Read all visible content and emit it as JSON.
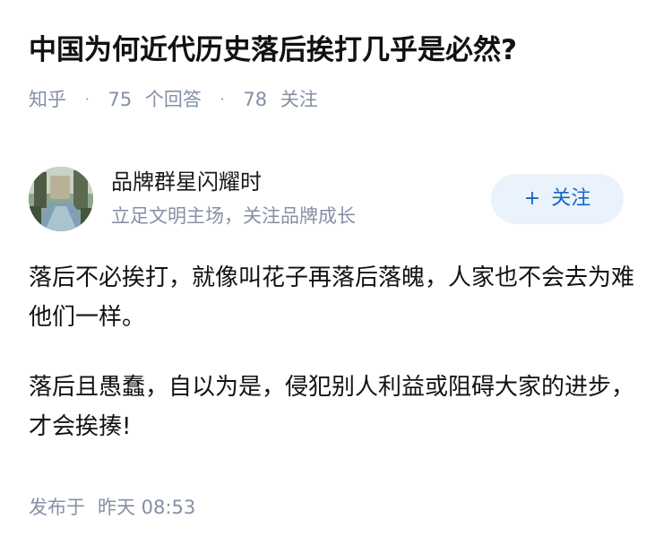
{
  "question": {
    "title": "中国为何近代历史落后挨打几乎是必然?"
  },
  "meta": {
    "source": "知乎",
    "separator": "·",
    "answers_count": "75",
    "answers_label": "个回答",
    "followers_count": "78",
    "followers_label": "关注"
  },
  "author": {
    "name": "品牌群星闪耀时",
    "bio": "立足文明主场，关注品牌成长",
    "follow_plus": "+",
    "follow_label": "关注",
    "avatar_icon": "avatar-photo"
  },
  "answer": {
    "paragraphs": [
      "落后不必挨打，就像叫花子再落后落魄，人家也不会去为难他们一样。",
      "落后且愚蠢，自以为是，侵犯别人利益或阻碍大家的进步，才会挨揍!"
    ]
  },
  "footer": {
    "published_label": "发布于",
    "published_time": "昨天 08:53"
  },
  "colors": {
    "title": "#111111",
    "meta_gray": "#8590a6",
    "follow_bg": "#eaf2fb",
    "follow_text": "#1765c8"
  }
}
